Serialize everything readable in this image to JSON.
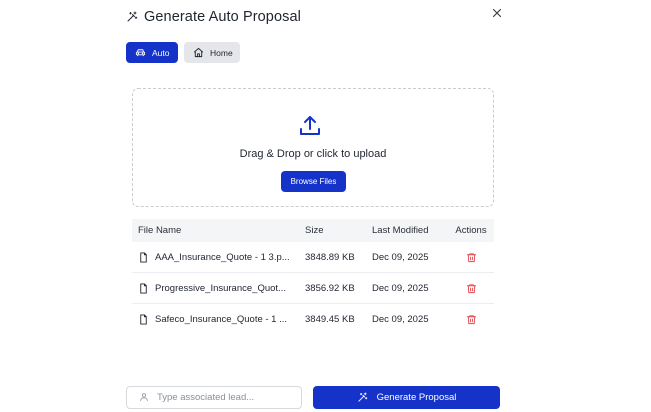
{
  "dialog": {
    "title": "Generate Auto Proposal",
    "title_icon": "magic-wand-icon",
    "close_icon": "close-icon"
  },
  "tabs": [
    {
      "label": "Auto",
      "icon": "car-icon",
      "active": true
    },
    {
      "label": "Home",
      "icon": "home-icon",
      "active": false
    }
  ],
  "upload": {
    "icon": "upload-icon",
    "prompt": "Drag & Drop or click to upload",
    "browse_label": "Browse Files"
  },
  "table": {
    "columns": [
      "File Name",
      "Size",
      "Last Modified",
      "Actions"
    ],
    "rows": [
      {
        "name": "AAA_Insurance_Quote - 1 3.p...",
        "size": "3848.89 KB",
        "modified": "Dec 09, 2025"
      },
      {
        "name": "Progressive_Insurance_Quot...",
        "size": "3856.92 KB",
        "modified": "Dec 09, 2025"
      },
      {
        "name": "Safeco_Insurance_Quote - 1 ...",
        "size": "3849.45 KB",
        "modified": "Dec 09, 2025"
      }
    ]
  },
  "footer": {
    "lead_placeholder": "Type associated lead...",
    "lead_value": "",
    "generate_label": "Generate Proposal"
  },
  "colors": {
    "primary": "#1533c8",
    "danger": "#e5484d",
    "tab_inactive": "#e4e6ea"
  }
}
